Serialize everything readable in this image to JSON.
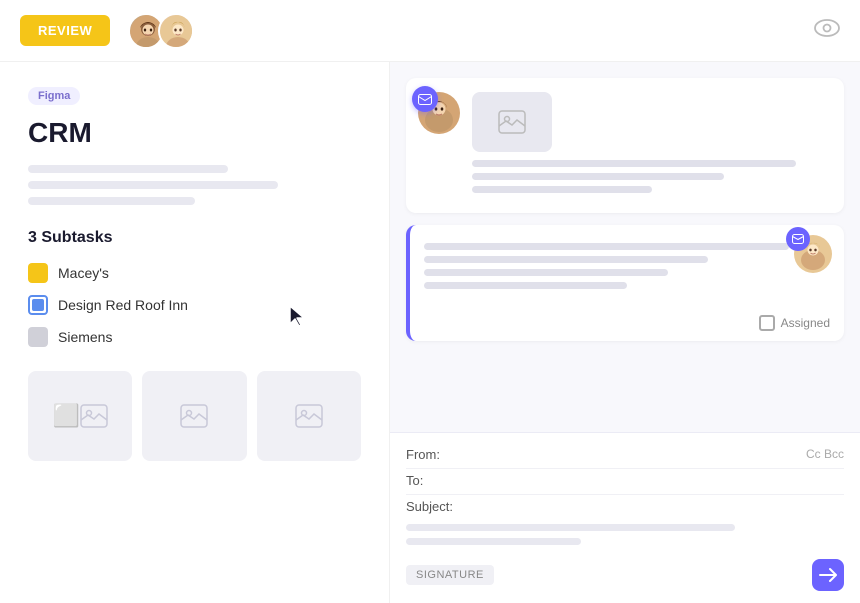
{
  "topbar": {
    "review_label": "REVIEW",
    "eye_icon": "eye-icon"
  },
  "left_panel": {
    "badge_label": "Figma",
    "project_title": "CRM",
    "subtasks_heading": "3 Subtasks",
    "subtasks": [
      {
        "id": 1,
        "label": "Macey's",
        "icon_type": "yellow"
      },
      {
        "id": 2,
        "label": "Design Red Roof Inn",
        "icon_type": "blue"
      },
      {
        "id": 3,
        "label": "Siemens",
        "icon_type": "gray"
      }
    ],
    "images": [
      {
        "id": 1
      },
      {
        "id": 2
      },
      {
        "id": 3
      }
    ]
  },
  "right_panel": {
    "card1": {
      "email_icon": "✉",
      "text_lines": [
        "long",
        "medium",
        "short"
      ]
    },
    "card2": {
      "email_icon": "✉",
      "assigned_label": "Assigned"
    },
    "compose": {
      "from_label": "From:",
      "to_label": "To:",
      "subject_label": "Subject:",
      "cc_bcc_label": "Cc Bcc",
      "signature_label": "SIGNATURE",
      "send_icon": "send-icon"
    }
  }
}
